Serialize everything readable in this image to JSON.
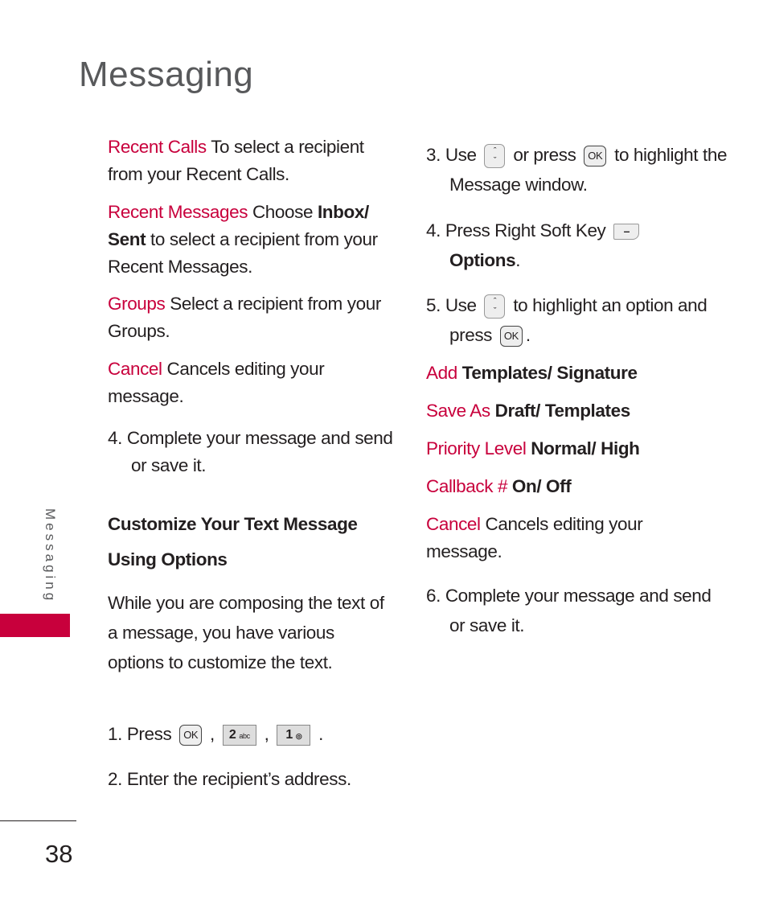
{
  "header": {
    "title": "Messaging"
  },
  "sidebar": {
    "label": "Messaging",
    "accent": "#c8003c"
  },
  "page_number": "38",
  "left": {
    "recent_calls": {
      "term": "Recent Calls",
      "text": " To select a recipient from your Recent Calls."
    },
    "recent_messages": {
      "term": "Recent Messages",
      "text1": " Choose ",
      "bold": "Inbox/ Sent",
      "text2": " to select a recipient from your Recent Messages."
    },
    "groups": {
      "term": "Groups",
      "text": " Select a recipient from your Groups."
    },
    "cancel": {
      "term": "Cancel",
      "text": "  Cancels editing your message."
    },
    "step4": "4. Complete your message and send or save it.",
    "heading1": "Customize Your Text Message",
    "heading2": "Using Options",
    "intro": "While you are composing the text of a message, you have various options to customize the text.",
    "step1": {
      "text": "1. Press ",
      "ok": "OK",
      "key2": "2",
      "key2_sub": "abc",
      "key1": "1",
      "sep": " , ",
      "end": " ."
    },
    "step2": "2. Enter the recipient’s address."
  },
  "right": {
    "step3": {
      "a": "3. Use ",
      "b": " or press ",
      "ok": "OK",
      "c": " to highlight the Message window."
    },
    "step4": {
      "a": "4. Press Right Soft Key ",
      "soft": "–",
      "bold": "Options",
      "end": "."
    },
    "step5": {
      "a": "5. Use ",
      "b": " to highlight an option and press ",
      "ok": "OK",
      "end": "."
    },
    "nav_up": "ˆ",
    "nav_down": "ˇ",
    "options": [
      {
        "term": "Add",
        "value": " Templates/ Signature"
      },
      {
        "term": "Save As",
        "value": " Draft/ Templates"
      },
      {
        "term": "Priority Level",
        "value": " Normal/ High"
      },
      {
        "term": "Callback #",
        "value": " On/ Off"
      }
    ],
    "cancel": {
      "term": "Cancel",
      "text": " Cancels editing your message."
    },
    "step6": "6. Complete your message and send or save it."
  }
}
